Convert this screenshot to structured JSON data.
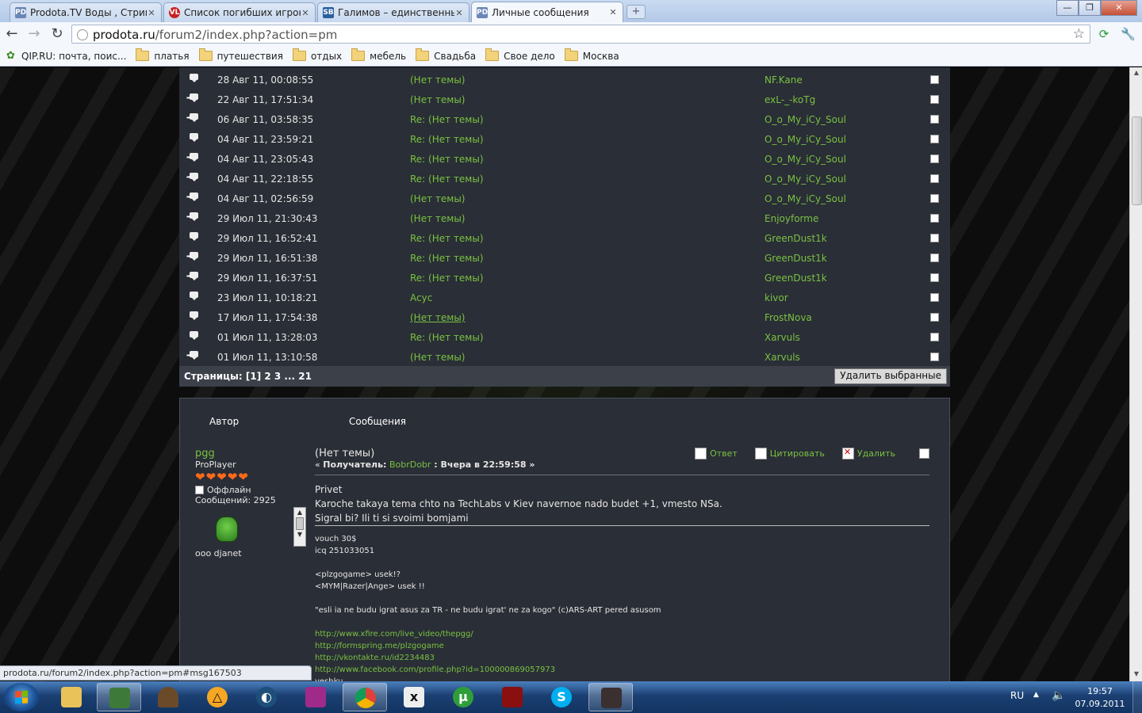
{
  "browser": {
    "tabs": [
      {
        "label": "Prodota.TV Воды , Стримы",
        "favicon": "PD"
      },
      {
        "label": "Список погибших игроков",
        "favicon": "VL"
      },
      {
        "label": "Галимов – единственный",
        "favicon": "SB"
      },
      {
        "label": "Личные сообщения",
        "favicon": "PD"
      }
    ],
    "url_domain": "prodota.ru",
    "url_path": "/forum2/index.php?action=pm",
    "bookmarks": [
      "QIP.RU: почта, поис...",
      "платья",
      "путешествия",
      "отдых",
      "мебель",
      "Свадьба",
      "Свое дело",
      "Москва"
    ],
    "status_url": "prodota.ru/forum2/index.php?action=pm#msg167503"
  },
  "pm_list": {
    "rows": [
      {
        "icon": "message-icon",
        "date": "28 Авг 11, 00:08:55",
        "subject": "(Нет темы)",
        "user": "NF.Kane"
      },
      {
        "icon": "replied-icon",
        "date": "22 Авг 11, 17:51:34",
        "subject": "(Нет темы)",
        "user": "exL-_-koTg"
      },
      {
        "icon": "replied-icon",
        "date": "06 Авг 11, 03:58:35",
        "subject": "Re: (Нет темы)",
        "user": "O_o_My_iCy_Soul"
      },
      {
        "icon": "message-icon",
        "date": "04 Авг 11, 23:59:21",
        "subject": "Re: (Нет темы)",
        "user": "O_o_My_iCy_Soul"
      },
      {
        "icon": "replied-icon",
        "date": "04 Авг 11, 23:05:43",
        "subject": "Re: (Нет темы)",
        "user": "O_o_My_iCy_Soul"
      },
      {
        "icon": "replied-icon",
        "date": "04 Авг 11, 22:18:55",
        "subject": "Re: (Нет темы)",
        "user": "O_o_My_iCy_Soul"
      },
      {
        "icon": "replied-icon",
        "date": "04 Авг 11, 02:56:59",
        "subject": "(Нет темы)",
        "user": "O_o_My_iCy_Soul"
      },
      {
        "icon": "replied-icon",
        "date": "29 Июл 11, 21:30:43",
        "subject": "(Нет темы)",
        "user": "Enjoyforme"
      },
      {
        "icon": "message-icon",
        "date": "29 Июл 11, 16:52:41",
        "subject": "Re: (Нет темы)",
        "user": "GreenDust1k"
      },
      {
        "icon": "replied-icon",
        "date": "29 Июл 11, 16:51:38",
        "subject": "Re: (Нет темы)",
        "user": "GreenDust1k"
      },
      {
        "icon": "replied-icon",
        "date": "29 Июл 11, 16:37:51",
        "subject": "Re: (Нет темы)",
        "user": "GreenDust1k"
      },
      {
        "icon": "message-icon",
        "date": "23 Июл 11, 10:18:21",
        "subject": "Acyc",
        "user": "kivor"
      },
      {
        "icon": "message-icon",
        "date": "17 Июл 11, 17:54:38",
        "subject": "(Нет темы)",
        "user": "FrostNova",
        "hover": true
      },
      {
        "icon": "message-icon",
        "date": "01 Июл 11, 13:28:03",
        "subject": "Re: (Нет темы)",
        "user": "Xarvuls"
      },
      {
        "icon": "replied-icon",
        "date": "01 Июл 11, 13:10:58",
        "subject": "(Нет темы)",
        "user": "Xarvuls"
      }
    ],
    "pager": "Страницы: [1] 2 3 ... 21",
    "delete_selected": "Удалить выбранные"
  },
  "message": {
    "header_author": "Автор",
    "header_messages": "Сообщения",
    "author": {
      "name": "pgg",
      "rank": "ProPlayer",
      "hearts": "❤❤❤❤❤",
      "status": "Оффлайн",
      "posts": "Сообщений: 2925",
      "personal_text": "ooo djanet"
    },
    "title": "(Нет темы)",
    "meta_prefix": "« ",
    "meta_recipient_label": "Получатель:",
    "meta_recipient": "BobrDobr",
    "meta_date_label": " : Вчера в 22:59:58 »",
    "actions": {
      "reply": "Ответ",
      "quote": "Цитировать",
      "delete": "Удалить"
    },
    "body": [
      "Privet",
      "Karoche takaya tema chto na TechLabs v Kiev navernoe nado budet +1, vmesto NSa.",
      "Sigral bi? Ili ti si svoimi bomjami"
    ],
    "signature": [
      {
        "text": "vouch 30$",
        "link": false
      },
      {
        "text": "icq 251033051",
        "link": false
      },
      {
        "text": "",
        "link": false
      },
      {
        "text": "<plzgogame> usek!?",
        "link": false
      },
      {
        "text": "<MYM|Razer|Ange> usek !!",
        "link": false
      },
      {
        "text": "",
        "link": false
      },
      {
        "text": "\"esli ia ne budu igrat asus za TR - ne budu igrat' ne za kogo\" (c)ARS-ART pered asusom",
        "link": false
      },
      {
        "text": "",
        "link": false
      },
      {
        "text": "http://www.xfire.com/live_video/thepgg/",
        "link": true
      },
      {
        "text": "http://formspring.me/plzgogame",
        "link": true
      },
      {
        "text": "http://vkontakte.ru/id2234483",
        "link": true
      },
      {
        "text": "http://www.facebook.com/profile.php?id=100000869057973",
        "link": true
      },
      {
        "text": "veshku",
        "link": false
      }
    ]
  },
  "taskbar": {
    "lang": "RU",
    "time": "19:57",
    "date": "07.09.2011"
  },
  "colors": {
    "accent_green": "#79c142",
    "panel": "#2a2e36"
  }
}
